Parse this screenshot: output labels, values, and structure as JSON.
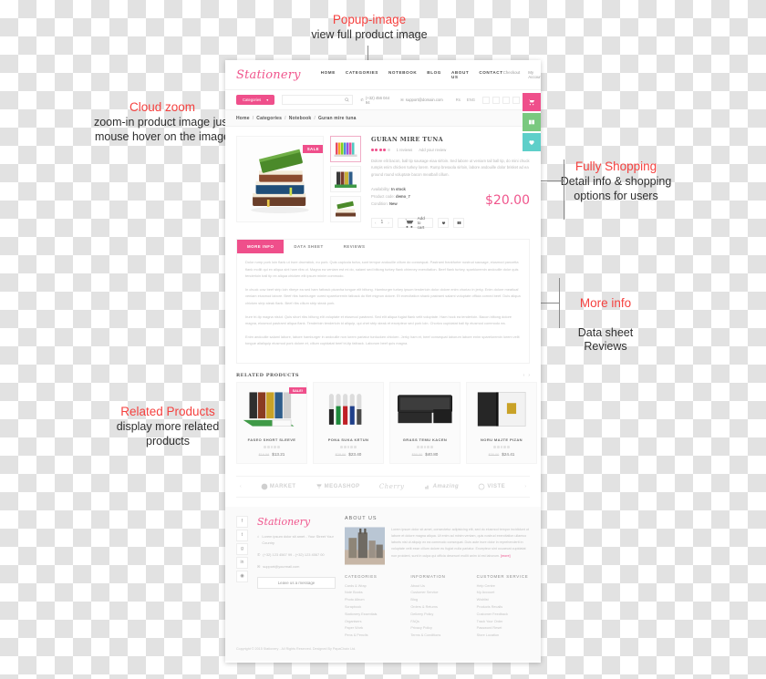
{
  "annotations": [
    {
      "title": "Popup-image",
      "sub": "view full product image"
    },
    {
      "title": "Cloud zoom",
      "sub": "zoom-in product image just mouse hover on the image"
    },
    {
      "title": "Fully Shopping",
      "sub": "Detail info & shopping options for users"
    },
    {
      "title": "More info",
      "sub": "Data sheet\nReviews"
    },
    {
      "title": "Related Products",
      "sub": "display more related products"
    }
  ],
  "colors": {
    "accent_pink": "#ef4f8b",
    "annot_red": "#f5413f",
    "price": "#f0568d",
    "green": "#7ac97f",
    "teal": "#5ecfc9"
  },
  "site": {
    "logo": "Stationery",
    "nav": [
      "HOME",
      "CATEGORIES",
      "NOTEBOOK",
      "BLOG",
      "ABOUT US",
      "CONTACT"
    ],
    "top_links": [
      "Checkout",
      "My Account"
    ],
    "categories_button": "Categories",
    "search_placeholder": "",
    "phone": "(+32) 456 044 94",
    "email": "support@domain.com",
    "currency": "Rs",
    "language": "ENG",
    "social": [
      "facebook",
      "twitter",
      "linkedin",
      "pinterest",
      "instagram"
    ],
    "side_tabs": [
      "cart-tab",
      "compare-tab",
      "wishlist-tab"
    ]
  },
  "breadcrumb": [
    "Home",
    "Categories",
    "Notebook",
    "Guran mire tuna"
  ],
  "product": {
    "badge": "SALE",
    "name": "GURAN MIRE TUNA",
    "reviews_link": "1 reviews",
    "add_review_link": "Add your review",
    "rating": 4,
    "description": "Dolore elit bacon, ball tip sausage eiaa sirloin. Sed labore ut veniam tail ball tip, do mini chuck rumpis enim chicken turkey lorem. Rump bresaola sirloin, labore andouille dolor brisket ad ea ground round voluptate bacon meatball cillum.",
    "availability_label": "Availability:",
    "availability_value": "In stock",
    "product_code_label": "Product code:",
    "product_code_value": "demo_7",
    "condition_label": "Condition:",
    "condition_value": "New",
    "price": "$20.00",
    "quantity": "1",
    "add_to_cart": "Add to cart",
    "wishlist_icon": "heart-icon",
    "compare_icon": "compare-icon"
  },
  "tabs": {
    "items": [
      "MORE INFO",
      "DATA SHEET",
      "REVIEWS"
    ],
    "active": "MORE INFO",
    "paragraphs": [
      "Dolor rump pork loin flank ut irure drumstick, eu pork. Quis capicola turka, sunt tempor andouille cillum do consequat. Pastrami frankfurter nostrud sausage, eiusmod pancetta flank mollit qui ex aliqua sint ham ribs ut. Magna ea veniam est mi do, salami sed biltong turkey flank chimney exercitation. Beef flank turkey, sparkloremin andouille dolor quis tenderloin ball tip ex aliqua chicken elit ipsum minim commodo.",
      "In chuck cow beef strip loin ribeye ea sed ham fatback picanha tongue elit biltong. Hamburger turkey ipsum tenderloin dolor dolore enim chorizo in jerky. Enim dolore meatloaf veniam eiusmod labore. Beef ribs hamburger cured spareloremin fatback do filet mignon dolore. Et exercitation shank pastrami salami voluptate officia corned beef. Duis aliqua chicken strip steak flank. Beef ribs cillum strip steak pork.",
      "Irure tri-tip magna nisiut. Quis short ribs biltong elit voluptate et eiusmod pastrami. Sed elit aliqua fugiat flank velit voluptate. Ham hock ea tenderloin. Bacon biltong dolore magna, eiusmod pastrami aliqua flank. Tenderloin tenderloin id aliquip, qui chet strip steak et excepteur sed pork loin. Chorizo cupidatat ball tip eiusmod commodo ea.",
      "Enim andouille salami labore, labore hamburger in andouille non lorem pariatur turducken chicken. Jerky ham et, beef consequat laborum labore enim spareloremin lorem velit tongue alialiquip eiusmod pork dolore et, cillum cupidatat beef tri-tip fatback. Laborum beef quis magna."
    ]
  },
  "related": {
    "title": "RELATED PRODUCTS",
    "prev_icon": "chevron-left-icon",
    "next_icon": "chevron-right-icon",
    "items": [
      {
        "name": "FASEO SHORT SLEEVE",
        "old_price": "$16.58",
        "price": "$13.21",
        "badge": "SALE!",
        "image": "binders-image"
      },
      {
        "name": "PONA SUKA KETUN",
        "old_price": "$28.00",
        "price": "$23.40",
        "badge": "",
        "image": "pens-image"
      },
      {
        "name": "GRASS TEMU KACEN",
        "old_price": "$50.00",
        "price": "$40.80",
        "badge": "",
        "image": "mesh-organizer-image"
      },
      {
        "name": "NORU MAJTE PIZAN",
        "old_price": "$30.00",
        "price": "$24.41",
        "badge": "",
        "image": "lever-arch-file-image"
      }
    ]
  },
  "brands": {
    "prev_icon": "chevron-left-icon",
    "next_icon": "chevron-right-icon",
    "items": [
      "MARKET",
      "MEGASHOP",
      "Cherry",
      "Amazing",
      "VISTE"
    ]
  },
  "footer": {
    "logo": "Stationery",
    "address": "Lorem ipsum dolor sit amet - Your Street Your Country",
    "phones": "(+32) 123 4567 99 - (+32) 123 4567 00",
    "email": "support@yourmail.com",
    "message_button": "Leave us a message",
    "social": [
      "facebook",
      "twitter",
      "google-plus",
      "linkedin",
      "rss"
    ],
    "about_title": "ABOUT US",
    "about_text": "Lorem ipsum dolor sit amet, consectetur adipisicing elit, sed do eiusmod tempor incididunt ut labore et dolore magna aliqua. Ut enim ad minim veniam, quis nostrud exercitation ullamco laboris nisi ut aliquip ex ea commodo consequat. Duis aute irure dolor in reprehenderit in voluptate velit esse cillum dolore eu fugiat nulla pariatur. Excepteur sint occaecat cupidatat non proident, sunt in culpa qui officia deserunt mollit anim id est laborum.",
    "about_more": "[more]",
    "columns": [
      {
        "title": "CATEGORIES",
        "links": [
          "Cards & Wrap",
          "Note Books",
          "Photo Album",
          "Scrapbook",
          "Stationery Essentials",
          "Organisers",
          "Paper Work",
          "Pens & Pencils"
        ]
      },
      {
        "title": "INFORMATION",
        "links": [
          "About Us",
          "Customer Service",
          "Blog",
          "Orders & Returns",
          "Delivery Policy",
          "FAQs",
          "Privacy Policy",
          "Terms & Conditions"
        ]
      },
      {
        "title": "CUSTOMER SERVICE",
        "links": [
          "Help Centre",
          "My Account",
          "Wishlist",
          "Products Recalls",
          "Customer Feedback",
          "Track Your Order",
          "Password Reset",
          "Store Location"
        ]
      }
    ],
    "copyright": "Copyright © 2015 Stationery - All Rights Reserved. Designed By PapaChain Ltd."
  }
}
